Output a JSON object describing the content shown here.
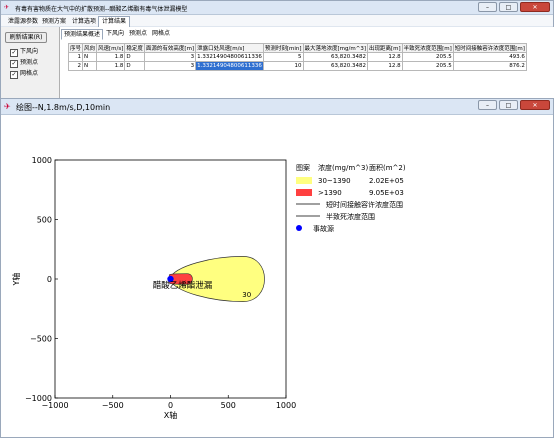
{
  "main_window": {
    "title": "有毒有害物质在大气中的扩散预测--醋酸乙烯酯有毒气体泄漏模型",
    "menu": [
      "泄露源参数",
      "预测方案",
      "计算选项",
      "计算结果"
    ],
    "left": {
      "refresh_label": "刷新结果(R)",
      "checks": [
        {
          "label": "下风向",
          "checked": true
        },
        {
          "label": "预测点",
          "checked": true
        },
        {
          "label": "网格点",
          "checked": true
        }
      ]
    },
    "subtabs": [
      "预测结果概述",
      "下风向",
      "预测点",
      "网格点"
    ],
    "table": {
      "headers": [
        "序号",
        "风向",
        "风速[m/s]",
        "稳定度",
        "面源的有效高度[m]",
        "泄露口处风速[m/s]",
        "预测时刻[min]",
        "最大落地浓度[mg/m^3]",
        "出现距离[m]",
        "半致死浓度范围[m]",
        "短时间接触容许浓度范围[m]"
      ],
      "rows": [
        [
          "1",
          "N",
          "1.8",
          "D",
          "3",
          "1.33214904800611336",
          "5",
          "63,820.3482",
          "12.8",
          "205.5",
          "493.6"
        ],
        [
          "2",
          "N",
          "1.8",
          "D",
          "3",
          "1.33214904800611336",
          "10",
          "63,820.3482",
          "12.8",
          "205.5",
          "876.2"
        ]
      ]
    }
  },
  "plot_window": {
    "title": "绘图--N,1.8m/s,D,10min"
  },
  "chart_data": {
    "type": "contour",
    "xlabel": "X轴",
    "ylabel": "Y轴",
    "xlim": [
      -1000,
      1000
    ],
    "ylim": [
      -1000,
      1000
    ],
    "xticks": [
      -1000,
      -500,
      0,
      500,
      1000
    ],
    "yticks": [
      -1000,
      -500,
      0,
      500,
      1000
    ],
    "legend": {
      "headers": [
        "图案",
        "浓度(mg/m^3)",
        "面积(m^2)"
      ],
      "entries": [
        {
          "pattern": "fill",
          "color": "#ffff80",
          "range": "30~1390",
          "area": "2.02E+05"
        },
        {
          "pattern": "fill",
          "color": "#ff4040",
          "range": ">1390",
          "area": "9.05E+03"
        },
        {
          "pattern": "line",
          "color": "#404040",
          "label": "短时间接触容许浓度范围"
        },
        {
          "pattern": "line",
          "color": "#404040",
          "label": "半致死浓度范围"
        },
        {
          "pattern": "dot",
          "color": "#0000ff",
          "label": "事故源"
        }
      ]
    },
    "plume_outer": {
      "level": 30,
      "x_end": 876.2,
      "half_width": 190,
      "color": "#ffff80"
    },
    "plume_inner": {
      "level": 1390,
      "x_end": 205.5,
      "half_width": 45,
      "color": "#ff4040"
    },
    "source": {
      "x": 0,
      "y": 0,
      "label": "醋酸乙烯酯泄漏"
    },
    "contour_label": "30"
  }
}
